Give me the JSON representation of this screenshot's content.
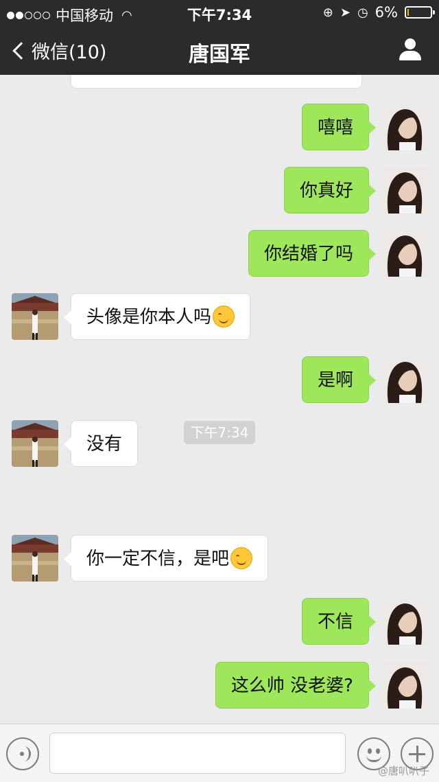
{
  "status_bar": {
    "carrier": "中国移动",
    "time": "下午7:34",
    "battery": "6%",
    "battery_level_percent": 6,
    "signal_bars": 2,
    "icons": [
      "wifi-icon",
      "orientation-lock-icon",
      "location-icon",
      "alarm-icon",
      "battery-icon"
    ]
  },
  "nav": {
    "back_label": "微信(10)",
    "title": "唐国军",
    "right_icon": "person-icon"
  },
  "messages": [
    {
      "side": "right",
      "text": "嘻嘻",
      "emoji": false
    },
    {
      "side": "right",
      "text": "你真好",
      "emoji": false
    },
    {
      "side": "right",
      "text": "你结婚了吗",
      "emoji": false
    },
    {
      "side": "left",
      "text": "头像是你本人吗",
      "emoji": true
    },
    {
      "side": "right",
      "text": "是啊",
      "emoji": false
    },
    {
      "side": "left",
      "text": "没有",
      "emoji": false
    },
    {
      "side": "time",
      "text": "下午7:34"
    },
    {
      "side": "left",
      "text": "你一定不信，是吧",
      "emoji": true
    },
    {
      "side": "right",
      "text": "不信",
      "emoji": false
    },
    {
      "side": "right",
      "text": "这么帅 没老婆?",
      "emoji": false
    }
  ],
  "input_bar": {
    "icons": [
      "voice-icon",
      "emoji-icon",
      "plus-icon"
    ]
  },
  "watermark": "@唐叭叭子",
  "colors": {
    "bar_background": "#2b2b2d",
    "chat_background": "#ebebeb",
    "sent_bubble": "#9ee65a",
    "received_bubble": "#ffffff"
  }
}
